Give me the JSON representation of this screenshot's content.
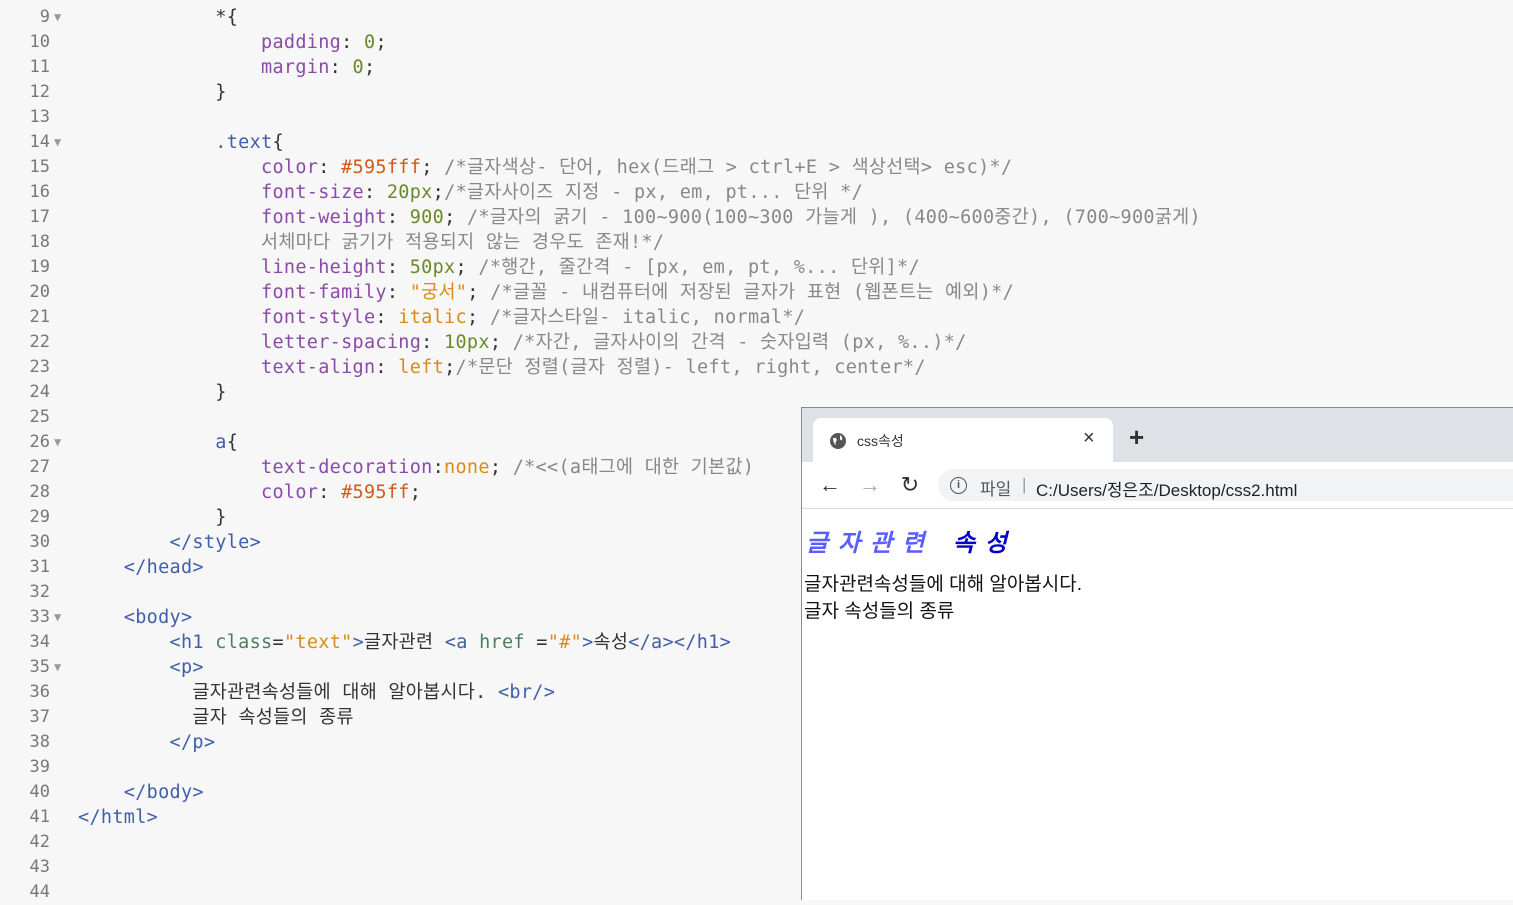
{
  "editor": {
    "lines": [
      {
        "n": "9",
        "fold": true,
        "html": "            <span class='txt'>*{</span>"
      },
      {
        "n": "10",
        "fold": false,
        "html": "                <span class='prop'>padding</span><span class='txt'>: </span><span class='num'>0</span><span class='txt'>;</span>"
      },
      {
        "n": "11",
        "fold": false,
        "html": "                <span class='prop'>margin</span><span class='txt'>: </span><span class='num'>0</span><span class='txt'>;</span>"
      },
      {
        "n": "12",
        "fold": false,
        "html": "            <span class='txt'>}</span>"
      },
      {
        "n": "13",
        "fold": false,
        "html": ""
      },
      {
        "n": "14",
        "fold": true,
        "html": "            <span class='sel'>.text</span><span class='txt'>{</span>"
      },
      {
        "n": "15",
        "fold": false,
        "html": "                <span class='prop'>color</span><span class='txt'>: </span><span class='hex'>#595fff</span><span class='txt'>; </span><span class='cmt'>/*글자색상- 단어, hex(드래그 > ctrl+E > 색상선택> esc)*/</span>"
      },
      {
        "n": "16",
        "fold": false,
        "html": "                <span class='prop'>font-size</span><span class='txt'>: </span><span class='num'>20px</span><span class='txt'>;</span><span class='cmt'>/*글자사이즈 지정 - px, em, pt... 단위 */</span>"
      },
      {
        "n": "17",
        "fold": false,
        "html": "                <span class='prop'>font-weight</span><span class='txt'>: </span><span class='num'>900</span><span class='txt'>; </span><span class='cmt'>/*글자의 굵기 - 100~900(100~300 가늘게 ), (400~600중간), (700~900굵게)</span>"
      },
      {
        "n": "18",
        "fold": false,
        "html": "                <span class='cmt'>서체마다 굵기가 적용되지 않는 경우도 존재!*/</span>"
      },
      {
        "n": "19",
        "fold": false,
        "html": "                <span class='prop'>line-height</span><span class='txt'>: </span><span class='num'>50px</span><span class='txt'>; </span><span class='cmt'>/*행간, 줄간격 - [px, em, pt, %... 단위]*/</span>"
      },
      {
        "n": "20",
        "fold": false,
        "html": "                <span class='prop'>font-family</span><span class='txt'>: </span><span class='str'>\"궁서\"</span><span class='txt'>; </span><span class='cmt'>/*글꼴 - 내컴퓨터에 저장된 글자가 표현 (웹폰트는 예외)*/</span>"
      },
      {
        "n": "21",
        "fold": false,
        "html": "                <span class='prop'>font-style</span><span class='txt'>: </span><span class='str'>italic</span><span class='txt'>; </span><span class='cmt'>/*글자스타일- italic, normal*/</span>"
      },
      {
        "n": "22",
        "fold": false,
        "html": "                <span class='prop'>letter-spacing</span><span class='txt'>: </span><span class='num'>10px</span><span class='txt'>; </span><span class='cmt'>/*자간, 글자사이의 간격 - 숫자입력 (px, %..)*/</span>"
      },
      {
        "n": "23",
        "fold": false,
        "html": "                <span class='prop'>text-align</span><span class='txt'>: </span><span class='str'>left</span><span class='txt'>;</span><span class='cmt'>/*문단 정렬(글자 정렬)- left, right, center*/</span>"
      },
      {
        "n": "24",
        "fold": false,
        "html": "            <span class='txt'>}</span>"
      },
      {
        "n": "25",
        "fold": false,
        "html": ""
      },
      {
        "n": "26",
        "fold": true,
        "html": "            <span class='sel'>a</span><span class='txt'>{</span>"
      },
      {
        "n": "27",
        "fold": false,
        "html": "                <span class='prop'>text-decoration</span><span class='txt'>:</span><span class='str'>none</span><span class='txt'>; </span><span class='cmt'>/*<<(a태그에 대한 기본값)</span>"
      },
      {
        "n": "28",
        "fold": false,
        "html": "                <span class='prop'>color</span><span class='txt'>: </span><span class='hex'>#595ff</span><span class='txt'>;</span>"
      },
      {
        "n": "29",
        "fold": false,
        "html": "            <span class='txt'>}</span>"
      },
      {
        "n": "30",
        "fold": false,
        "html": "        <span class='tag'>&lt;/style&gt;</span>"
      },
      {
        "n": "31",
        "fold": false,
        "html": "    <span class='tag'>&lt;/head&gt;</span>"
      },
      {
        "n": "32",
        "fold": false,
        "html": ""
      },
      {
        "n": "33",
        "fold": true,
        "html": "    <span class='tag'>&lt;body&gt;</span>"
      },
      {
        "n": "34",
        "fold": false,
        "html": "        <span class='tag'>&lt;h1 </span><span class='attr'>class</span><span class='txt'>=</span><span class='str'>\"text\"</span><span class='tag'>&gt;</span><span class='txt'>글자관련 </span><span class='tag'>&lt;a </span><span class='attr'>href</span><span class='txt'> =</span><span class='str'>\"#\"</span><span class='tag'>&gt;</span><span class='txt'>속성</span><span class='tag'>&lt;/a&gt;&lt;/h1&gt;</span>"
      },
      {
        "n": "35",
        "fold": true,
        "html": "        <span class='tag'>&lt;p&gt;</span>"
      },
      {
        "n": "36",
        "fold": false,
        "html": "          <span class='txt'>글자관련속성들에 대해 알아봅시다. </span><span class='tag'>&lt;br/&gt;</span>"
      },
      {
        "n": "37",
        "fold": false,
        "html": "          <span class='txt'>글자 속성들의 종류</span>"
      },
      {
        "n": "38",
        "fold": false,
        "html": "        <span class='tag'>&lt;/p&gt;</span>"
      },
      {
        "n": "39",
        "fold": false,
        "html": ""
      },
      {
        "n": "40",
        "fold": false,
        "html": "    <span class='tag'>&lt;/body&gt;</span>"
      },
      {
        "n": "41",
        "fold": false,
        "html": "<span class='tag'>&lt;/html&gt;</span>"
      },
      {
        "n": "42",
        "fold": false,
        "html": ""
      },
      {
        "n": "43",
        "fold": false,
        "html": ""
      },
      {
        "n": "44",
        "fold": false,
        "html": ""
      }
    ]
  },
  "browser": {
    "tab_title": "css속성",
    "tab_close": "×",
    "new_tab": "+",
    "back": "←",
    "forward": "→",
    "reload": "↻",
    "info": "i",
    "url_prefix": "파일",
    "url_sep": "|",
    "url": "C:/Users/정은조/Desktop/css2.html",
    "page": {
      "h1_text": "글자관련",
      "h1_link": "속성",
      "p_line1": "글자관련속성들에 대해 알아봅시다.",
      "p_line2": "글자 속성들의 종류"
    }
  }
}
